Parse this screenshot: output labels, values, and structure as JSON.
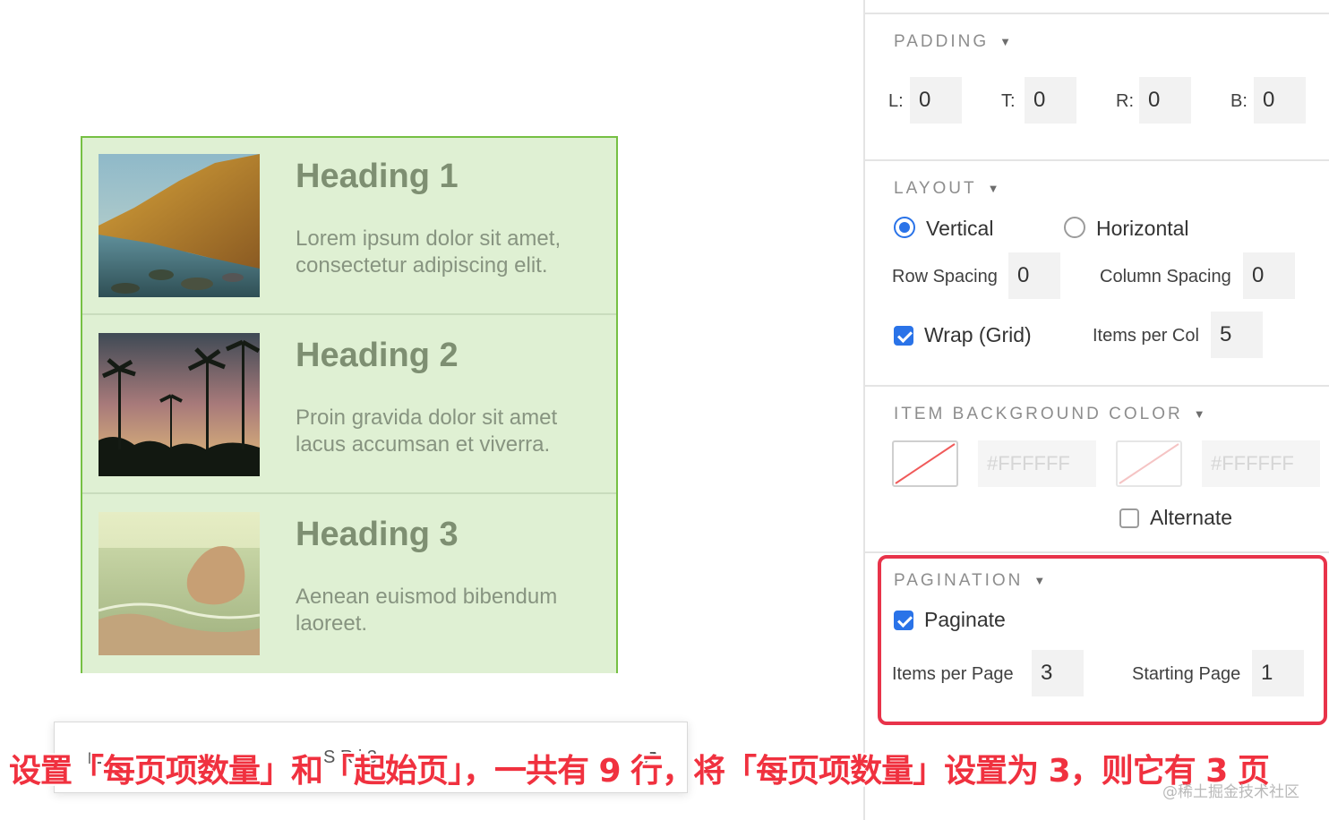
{
  "canvas": {
    "cards": [
      {
        "heading": "Heading 1",
        "text": "Lorem ipsum dolor sit amet, consectetur adipiscing elit.",
        "image": "coastal-cliff-photo"
      },
      {
        "heading": "Heading 2",
        "text": "Proin gravida dolor sit amet lacus accumsan et viverra.",
        "image": "palm-trees-sunset-photo"
      },
      {
        "heading": "Heading 3",
        "text": "Aenean euismod bibendum laoreet.",
        "image": "beach-rock-photo"
      }
    ],
    "toolbar": {
      "partial_text": "S R    i          3"
    }
  },
  "panel": {
    "padding": {
      "title": "PADDING",
      "fields": [
        {
          "label": "L:",
          "value": "0"
        },
        {
          "label": "T:",
          "value": "0"
        },
        {
          "label": "R:",
          "value": "0"
        },
        {
          "label": "B:",
          "value": "0"
        }
      ]
    },
    "layout": {
      "title": "LAYOUT",
      "vertical_label": "Vertical",
      "horizontal_label": "Horizontal",
      "selected": "Vertical",
      "row_spacing_label": "Row Spacing",
      "row_spacing_value": "0",
      "column_spacing_label": "Column Spacing",
      "column_spacing_value": "0",
      "wrap_label": "Wrap (Grid)",
      "wrap_checked": true,
      "items_per_col_label": "Items per Col",
      "items_per_col_value": "5"
    },
    "item_bg": {
      "title": "ITEM BACKGROUND COLOR",
      "color1": "#FFFFFF",
      "color2": "#FFFFFF",
      "alternate_label": "Alternate",
      "alternate_checked": false
    },
    "pagination": {
      "title": "PAGINATION",
      "paginate_label": "Paginate",
      "paginate_checked": true,
      "items_per_page_label": "Items per Page",
      "items_per_page_value": "3",
      "starting_page_label": "Starting Page",
      "starting_page_value": "1"
    }
  },
  "caption": "设置「每页项数量」和「起始页」，一共有 9 行，将「每页项数量」设置为 3，则它有 3 页",
  "watermark": "@稀土掘金技术社区",
  "colors": {
    "accent": "#2a73e8",
    "highlight": "#e8334a",
    "grid_border": "#76c043",
    "grid_fill": "#dff0d3"
  }
}
